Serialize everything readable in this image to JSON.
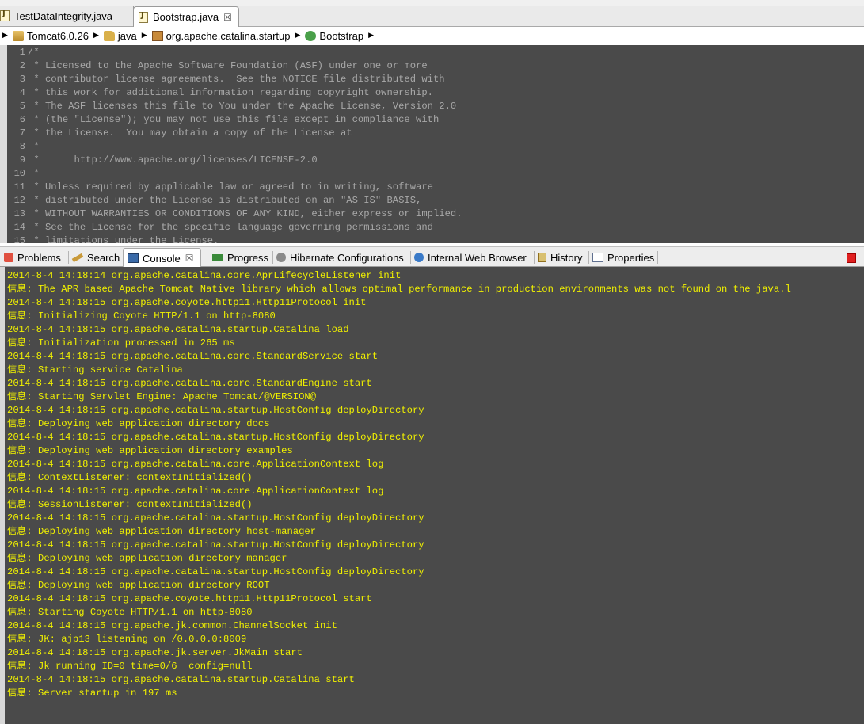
{
  "editor_tabs": [
    {
      "label": "TestDataIntegrity.java",
      "active": false
    },
    {
      "label": "Bootstrap.java",
      "active": true,
      "close": "☒"
    }
  ],
  "breadcrumb": [
    {
      "label": "Tomcat6.0.26",
      "icon": "project-icon"
    },
    {
      "label": "java",
      "icon": "source-folder-icon"
    },
    {
      "label": "org.apache.catalina.startup",
      "icon": "package-icon"
    },
    {
      "label": "Bootstrap",
      "icon": "class-icon"
    }
  ],
  "editor": {
    "line_numbers": [
      "1",
      "2",
      "3",
      "4",
      "5",
      "6",
      "7",
      "8",
      "9",
      "10",
      "11",
      "12",
      "13",
      "14",
      "15"
    ],
    "lines": [
      "/*",
      " * Licensed to the Apache Software Foundation (ASF) under one or more",
      " * contributor license agreements.  See the NOTICE file distributed with",
      " * this work for additional information regarding copyright ownership.",
      " * The ASF licenses this file to You under the Apache License, Version 2.0",
      " * (the \"License\"); you may not use this file except in compliance with",
      " * the License.  You may obtain a copy of the License at",
      " *",
      " *      http://www.apache.org/licenses/LICENSE-2.0",
      " *",
      " * Unless required by applicable law or agreed to in writing, software",
      " * distributed under the License is distributed on an \"AS IS\" BASIS,",
      " * WITHOUT WARRANTIES OR CONDITIONS OF ANY KIND, either express or implied.",
      " * See the License for the specific language governing permissions and",
      " * limitations under the License."
    ]
  },
  "view_tabs": [
    {
      "label": "Problems",
      "icon": "problems-icon",
      "active": false
    },
    {
      "label": "Search",
      "icon": "search-icon",
      "active": false
    },
    {
      "label": "Console",
      "icon": "console-icon",
      "active": true,
      "close": "☒"
    },
    {
      "label": "Progress",
      "icon": "progress-icon",
      "active": false
    },
    {
      "label": "Hibernate Configurations",
      "icon": "hibernate-icon",
      "active": false
    },
    {
      "label": "Internal Web Browser",
      "icon": "globe-icon",
      "active": false
    },
    {
      "label": "History",
      "icon": "history-icon",
      "active": false
    },
    {
      "label": "Properties",
      "icon": "properties-icon",
      "active": false
    }
  ],
  "console": {
    "lines": [
      "2014-8-4 14:18:14 org.apache.catalina.core.AprLifecycleListener init",
      "信息: The APR based Apache Tomcat Native library which allows optimal performance in production environments was not found on the java.l",
      "2014-8-4 14:18:15 org.apache.coyote.http11.Http11Protocol init",
      "信息: Initializing Coyote HTTP/1.1 on http-8080",
      "2014-8-4 14:18:15 org.apache.catalina.startup.Catalina load",
      "信息: Initialization processed in 265 ms",
      "2014-8-4 14:18:15 org.apache.catalina.core.StandardService start",
      "信息: Starting service Catalina",
      "2014-8-4 14:18:15 org.apache.catalina.core.StandardEngine start",
      "信息: Starting Servlet Engine: Apache Tomcat/@VERSION@",
      "2014-8-4 14:18:15 org.apache.catalina.startup.HostConfig deployDirectory",
      "信息: Deploying web application directory docs",
      "2014-8-4 14:18:15 org.apache.catalina.startup.HostConfig deployDirectory",
      "信息: Deploying web application directory examples",
      "2014-8-4 14:18:15 org.apache.catalina.core.ApplicationContext log",
      "信息: ContextListener: contextInitialized()",
      "2014-8-4 14:18:15 org.apache.catalina.core.ApplicationContext log",
      "信息: SessionListener: contextInitialized()",
      "2014-8-4 14:18:15 org.apache.catalina.startup.HostConfig deployDirectory",
      "信息: Deploying web application directory host-manager",
      "2014-8-4 14:18:15 org.apache.catalina.startup.HostConfig deployDirectory",
      "信息: Deploying web application directory manager",
      "2014-8-4 14:18:15 org.apache.catalina.startup.HostConfig deployDirectory",
      "信息: Deploying web application directory ROOT",
      "2014-8-4 14:18:15 org.apache.coyote.http11.Http11Protocol start",
      "信息: Starting Coyote HTTP/1.1 on http-8080",
      "2014-8-4 14:18:15 org.apache.jk.common.ChannelSocket init",
      "信息: JK: ajp13 listening on /0.0.0.0:8009",
      "2014-8-4 14:18:15 org.apache.jk.server.JkMain start",
      "信息: Jk running ID=0 time=0/6  config=null",
      "2014-8-4 14:18:15 org.apache.catalina.startup.Catalina start",
      "信息: Server startup in 197 ms"
    ]
  },
  "colors": {
    "console_bg": "#4a4a4a",
    "console_text": "#f0f000",
    "editor_comment": "#a8a8a8"
  }
}
